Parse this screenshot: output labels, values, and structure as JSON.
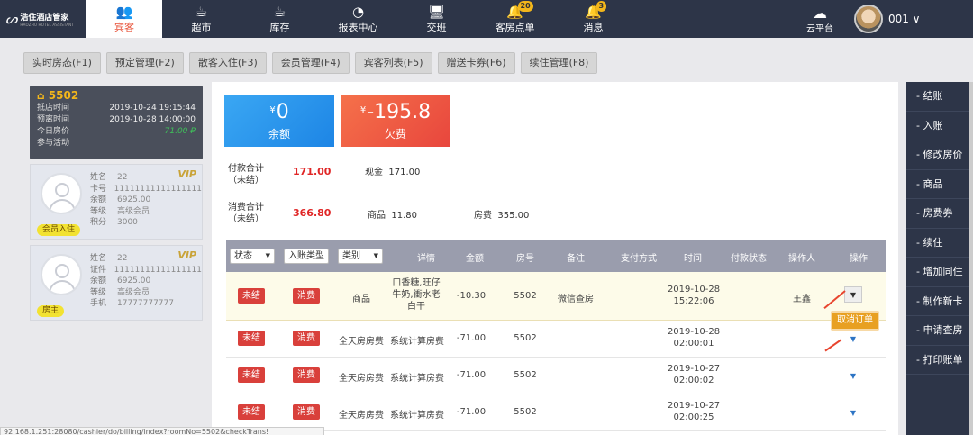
{
  "logo": {
    "mark": "ᔕ",
    "title": "浩住酒店管家",
    "subtitle": "HAOZHU HOTEL ASSISTANT"
  },
  "nav": {
    "items": [
      {
        "label": "宾客",
        "icon": "guests-icon",
        "glyph": "👥",
        "active": true
      },
      {
        "label": "超市",
        "icon": "cup-icon",
        "glyph": "☕"
      },
      {
        "label": "库存",
        "icon": "cup-icon",
        "glyph": "☕"
      },
      {
        "label": "报表中心",
        "icon": "pie-chart-icon",
        "glyph": "◔"
      },
      {
        "label": "交班",
        "icon": "monitor-icon",
        "glyph": "🖥"
      },
      {
        "label": "客房点单",
        "icon": "bell-icon",
        "glyph": "🔔",
        "badge": "20"
      },
      {
        "label": "消息",
        "icon": "bell-icon",
        "glyph": "🔔",
        "badge": "3"
      }
    ],
    "cloud_label": "云平台",
    "user_name": "001 ∨"
  },
  "tabs": [
    "实时房态(F1)",
    "预定管理(F2)",
    "散客入住(F3)",
    "会员管理(F4)",
    "宾客列表(F5)",
    "赠送卡券(F6)",
    "续住管理(F8)"
  ],
  "room": {
    "number": "5502",
    "rows": [
      {
        "k": "抵店时间",
        "v": "2019-10-24 19:15:44"
      },
      {
        "k": "预离时间",
        "v": "2019-10-28 14:00:00"
      },
      {
        "k": "今日房价",
        "v": "71.00 ₽"
      },
      {
        "k": "参与活动",
        "v": ""
      }
    ]
  },
  "guests": [
    {
      "tag": "会员入住",
      "vip": "VIP",
      "rows": [
        {
          "k": "姓名",
          "v": "22"
        },
        {
          "k": "卡号",
          "v": "11111111111111111"
        },
        {
          "k": "余额",
          "v": "6925.00"
        },
        {
          "k": "等级",
          "v": "高级会员"
        },
        {
          "k": "积分",
          "v": "3000"
        }
      ]
    },
    {
      "tag": "房主",
      "vip": "VIP",
      "rows": [
        {
          "k": "姓名",
          "v": "22"
        },
        {
          "k": "证件",
          "v": "11111111111111111"
        },
        {
          "k": "余额",
          "v": "6925.00"
        },
        {
          "k": "等级",
          "v": "高级会员"
        },
        {
          "k": "手机",
          "v": "17777777777"
        }
      ]
    }
  ],
  "balance": {
    "currency": "¥",
    "amount": "0",
    "label": "余额"
  },
  "owed": {
    "currency": "¥",
    "amount": "-195.8",
    "label": "欠费"
  },
  "payment": {
    "label": "付款合计（未结）",
    "total": "171.00",
    "items": [
      {
        "k": "现金",
        "v": "171.00"
      }
    ]
  },
  "consume": {
    "label": "消费合计（未结）",
    "total": "366.80",
    "items": [
      {
        "k": "商品",
        "v": "11.80"
      },
      {
        "k": "房费",
        "v": "355.00"
      }
    ]
  },
  "table": {
    "filters": {
      "status": "状态",
      "entry_type": "入账类型",
      "category": "类别"
    },
    "headers": [
      "详情",
      "金额",
      "房号",
      "备注",
      "支付方式",
      "时间",
      "付款状态",
      "操作人",
      "操作"
    ],
    "rows": [
      {
        "status": "未结",
        "type": "消费",
        "category": "商品",
        "detail": "口香糖,旺仔牛奶,衝水老白干",
        "amount": "-10.30",
        "room": "5502",
        "note": "微信查房",
        "pay": "",
        "date": "2019-10-28",
        "time": "15:22:06",
        "pay_status": "",
        "operator": "王鑫"
      },
      {
        "status": "未结",
        "type": "消费",
        "category": "全天房房费",
        "detail": "系统计算房费",
        "amount": "-71.00",
        "room": "5502",
        "note": "",
        "pay": "",
        "date": "2019-10-28",
        "time": "02:00:01",
        "pay_status": "",
        "operator": ""
      },
      {
        "status": "未结",
        "type": "消费",
        "category": "全天房房费",
        "detail": "系统计算房费",
        "amount": "-71.00",
        "room": "5502",
        "note": "",
        "pay": "",
        "date": "2019-10-27",
        "time": "02:00:02",
        "pay_status": "",
        "operator": ""
      },
      {
        "status": "未结",
        "type": "消费",
        "category": "全天房房费",
        "detail": "系统计算房费",
        "amount": "-71.00",
        "room": "5502",
        "note": "",
        "pay": "",
        "date": "2019-10-27",
        "time": "02:00:25",
        "pay_status": "",
        "operator": ""
      }
    ],
    "cancel_label": "取消订单"
  },
  "right_menu": [
    "- 结账",
    "- 入账",
    "- 修改房价",
    "- 商品",
    "- 房费券",
    "- 续住",
    "- 增加同住",
    "- 制作新卡",
    "- 申请查房",
    "- 打印账单"
  ],
  "status_url": "92.168.1.251:28080/cashier/do/billing/index?roomNo=5502&checkTrans!",
  "colors": {
    "nav_bg": "#2d3548",
    "accent": "#e8543b",
    "blue": "#1d85e5",
    "red": "#e8463d",
    "vip_gold": "#c9a338"
  }
}
